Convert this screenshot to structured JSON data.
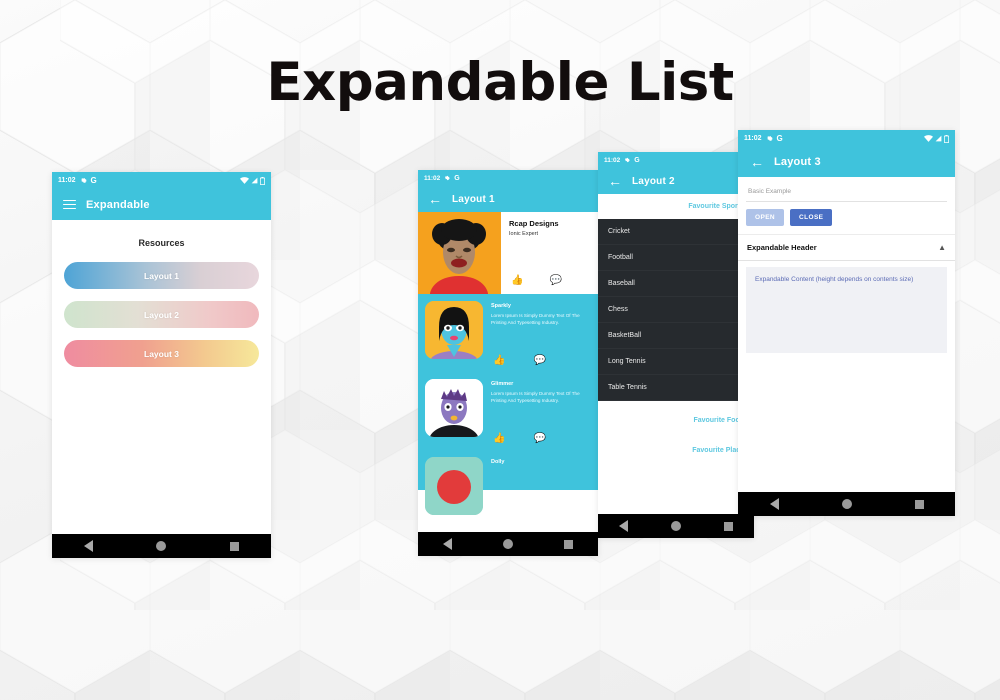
{
  "page": {
    "title": "Expandable List",
    "background_color": "#f2f2f2",
    "accent_color": "#3fc3dc"
  },
  "status_bar": {
    "time": "11:02",
    "gear_icon": "gear-icon",
    "g_icon": "google-icon",
    "wifi_icon": "wifi-icon",
    "signal_icon": "signal-icon",
    "battery_icon": "battery-icon"
  },
  "nav_bar": {
    "back_icon": "back-triangle-icon",
    "home_icon": "home-circle-icon",
    "recents_icon": "recents-square-icon"
  },
  "phone1": {
    "appbar": {
      "menu_icon": "hamburger-menu-icon",
      "title": "Expandable"
    },
    "section_title": "Resources",
    "buttons": [
      {
        "label": "Layout 1",
        "gradient": "#4ea4d6 → #e8d6dc"
      },
      {
        "label": "Layout 2",
        "gradient": "#cfe4cd → #f0b9bd"
      },
      {
        "label": "Layout 3",
        "gradient": "#ef8ca0 → #f6e89a"
      }
    ]
  },
  "phone2": {
    "appbar": {
      "back_icon": "back-arrow-icon",
      "title": "Layout 1"
    },
    "feature_card": {
      "name": "Rcap Designs",
      "subtitle": "Ionic Expert",
      "like_icon": "thumbs-up-icon",
      "comment_icon": "comment-icon",
      "art_bg": "#f5a11e"
    },
    "cards": [
      {
        "name": "Sparkly",
        "text": "Lorem Ipsum Is Simply Dummy Text Of The Printing And Typesetting Industry.",
        "avatar_bg": "#f7b731",
        "like_icon": "thumbs-up-icon",
        "comment_icon": "comment-icon"
      },
      {
        "name": "Glimmer",
        "text": "Lorem Ipsum Is Simply Dummy Text Of The Printing And Typesetting Industry.",
        "avatar_bg": "#ffffff",
        "like_icon": "thumbs-up-icon",
        "comment_icon": "comment-icon"
      },
      {
        "name": "Dolly",
        "text": "",
        "avatar_bg": "#8fd6c8",
        "like_icon": "thumbs-up-icon",
        "comment_icon": "comment-icon"
      }
    ]
  },
  "phone3": {
    "appbar": {
      "back_icon": "back-arrow-icon",
      "title": "Layout 2"
    },
    "groups": [
      {
        "label": "Favourite Sports",
        "expanded": true,
        "items": [
          "Cricket",
          "Football",
          "Baseball",
          "Chess",
          "BasketBall",
          "Long Tennis",
          "Table Tennis"
        ]
      },
      {
        "label": "Favourite Food",
        "expanded": false,
        "items": []
      },
      {
        "label": "Favourite Place",
        "expanded": false,
        "items": []
      }
    ]
  },
  "phone4": {
    "appbar": {
      "back_icon": "back-arrow-icon",
      "title": "Layout 3"
    },
    "input_placeholder": "Basic Example",
    "open_button": "OPEN",
    "close_button": "CLOSE",
    "expandable_header": "Expandable Header",
    "chevron_icon": "chevron-up-icon",
    "expandable_content": "Expandable Content (height depends on contents size)"
  }
}
